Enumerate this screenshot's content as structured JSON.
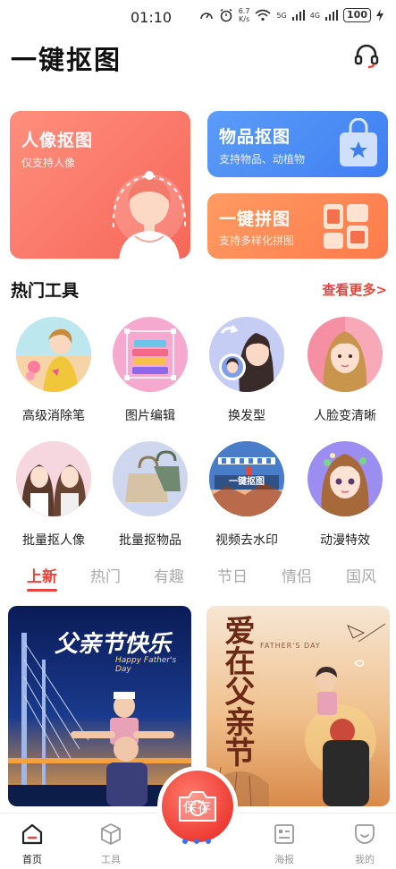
{
  "status_bar": {
    "time": "01:10",
    "net_speed_value": "6.7",
    "net_speed_unit": "K/s",
    "signal_1": "5G",
    "signal_2": "4G",
    "battery": "100"
  },
  "header": {
    "title": "一键抠图",
    "support_icon": "headset-icon"
  },
  "feature_cards": {
    "portrait": {
      "title": "人像抠图",
      "subtitle": "仅支持人像"
    },
    "goods": {
      "title": "物品抠图",
      "subtitle": "支持物品、动植物"
    },
    "collage": {
      "title": "一键拼图",
      "subtitle": "支持多样化拼图"
    }
  },
  "hot_tools": {
    "title": "热门工具",
    "more": "查看更多>",
    "items": [
      {
        "label": "高级消除笔"
      },
      {
        "label": "图片编辑"
      },
      {
        "label": "换发型"
      },
      {
        "label": "人脸变清晰"
      },
      {
        "label": "批量抠人像"
      },
      {
        "label": "批量抠物品"
      },
      {
        "label": "视频去水印",
        "badge": "一键抠图"
      },
      {
        "label": "动漫特效"
      }
    ]
  },
  "template_tabs": [
    {
      "label": "上新",
      "active": true
    },
    {
      "label": "热门"
    },
    {
      "label": "有趣"
    },
    {
      "label": "节日"
    },
    {
      "label": "情侣"
    },
    {
      "label": "国风"
    }
  ],
  "posters": {
    "left": {
      "title": "父亲节快乐",
      "subtitle": "Happy Father's Day"
    },
    "right": {
      "title": "爱在父亲节",
      "subtitle": "FATHER'S DAY"
    }
  },
  "camera": {
    "label": "保存"
  },
  "bottom_nav": [
    {
      "label": "首页",
      "icon": "home-icon",
      "active": true
    },
    {
      "label": "工具",
      "icon": "cube-icon"
    },
    {
      "label": "海报",
      "icon": "poster-icon"
    },
    {
      "label": "我的",
      "icon": "profile-icon"
    }
  ],
  "colors": {
    "accent": "#e8453c",
    "portrait_card": "#f6675a",
    "goods_card": "#3f7ff2",
    "collage_card": "#fd7a4b"
  }
}
